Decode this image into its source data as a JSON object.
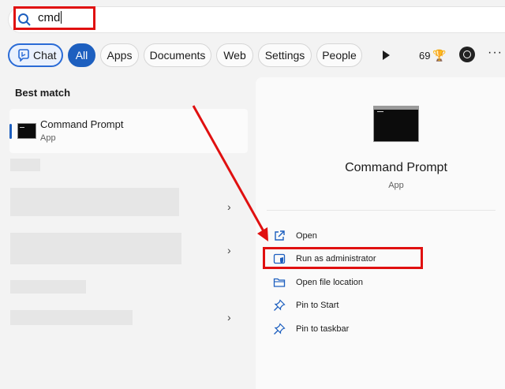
{
  "search": {
    "value": "cmd"
  },
  "filters": {
    "chat": "Chat",
    "all": "All",
    "apps": "Apps",
    "documents": "Documents",
    "web": "Web",
    "settings": "Settings",
    "people": "People",
    "points": "69"
  },
  "results": {
    "best_match_heading": "Best match",
    "best_match": {
      "title": "Command Prompt",
      "subtitle": "App"
    }
  },
  "detail": {
    "title": "Command Prompt",
    "subtitle": "App",
    "actions": [
      {
        "label": "Open",
        "icon": "open-external-icon"
      },
      {
        "label": "Run as administrator",
        "icon": "shield-admin-icon"
      },
      {
        "label": "Open file location",
        "icon": "folder-icon"
      },
      {
        "label": "Pin to Start",
        "icon": "pin-icon"
      },
      {
        "label": "Pin to taskbar",
        "icon": "pin-icon"
      }
    ]
  },
  "colors": {
    "accent": "#1d5fbf",
    "annotation": "#e01010"
  }
}
